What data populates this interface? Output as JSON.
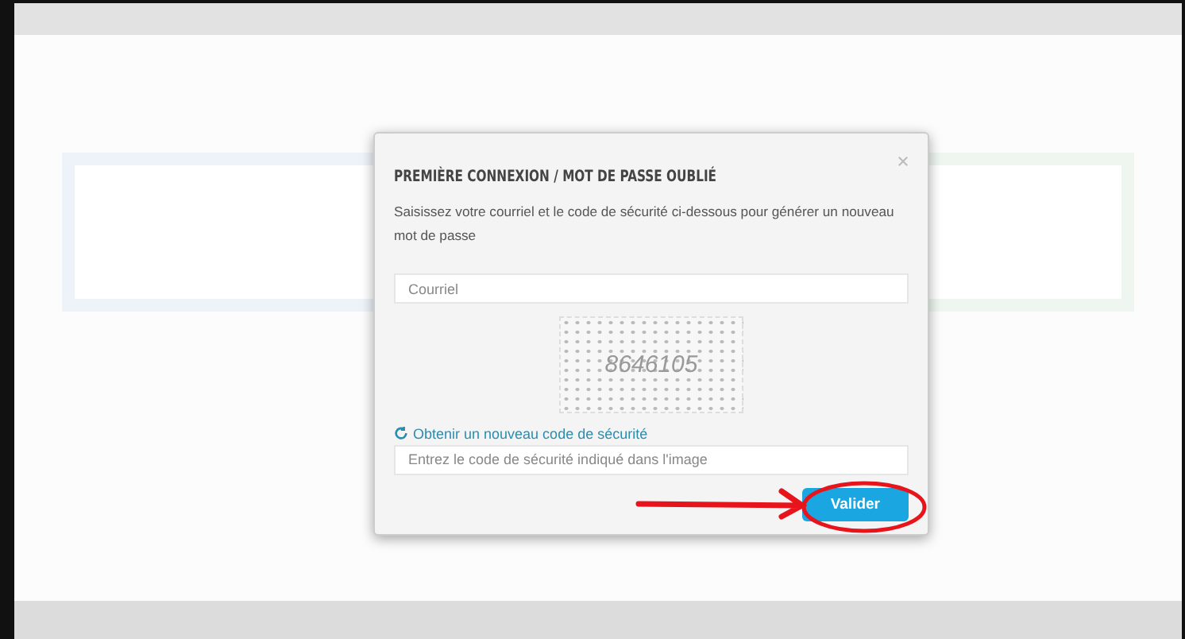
{
  "modal": {
    "title": "PREMIÈRE CONNEXION / MOT DE PASSE OUBLIÉ",
    "description": "Saisissez votre courriel et le code de sécurité ci-dessous pour générer un nouveau mot de passe",
    "email": {
      "placeholder": "Courriel"
    },
    "captcha": "8646105",
    "refresh_link": "Obtenir un nouveau code de sécurité",
    "code": {
      "placeholder": "Entrez le code de sécurité indiqué dans l'image"
    },
    "submit": "Valider"
  }
}
